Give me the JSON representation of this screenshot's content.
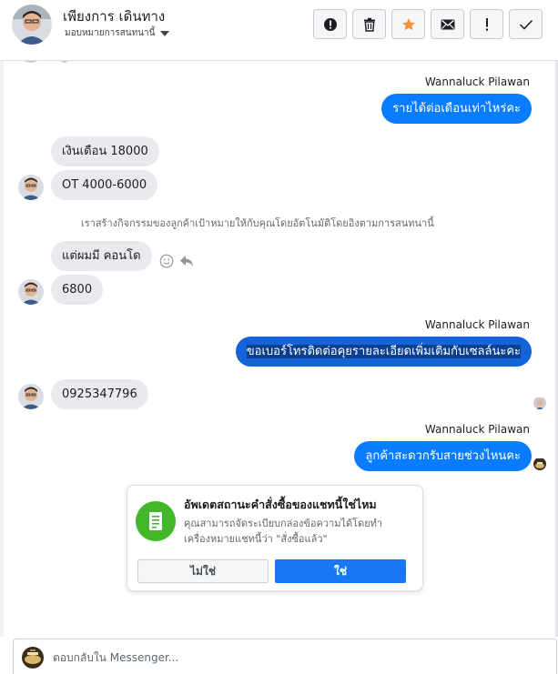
{
  "header": {
    "contact_name": "เพียงการ เดินทาง",
    "assign_label": "มอบหมายการสนทนานี้",
    "toolbar": [
      {
        "icon": "alert-circle-icon",
        "tooltip": ""
      },
      {
        "icon": "trash-icon",
        "tooltip": ""
      },
      {
        "icon": "star-icon",
        "tooltip": ""
      },
      {
        "icon": "envelope-icon",
        "tooltip": ""
      },
      {
        "icon": "exclamation-icon",
        "tooltip": ""
      },
      {
        "icon": "check-icon",
        "tooltip": ""
      }
    ]
  },
  "thread": {
    "sender_1": "Wannaluck Pilawan",
    "out_1": "รายได้ต่อเดือนเท่าไหร่คะ",
    "in_1": "เงินเดือน 18000",
    "in_2": "OT 4000-6000",
    "system_note": "เราสร้างกิจกรรมของลูกค้าเป้าหมายให้กับคุณโดยอัตโนมัติโดยอิงตามการสนทนานี้",
    "in_3": "แต่ผมมี คอนโด",
    "in_4": "6800",
    "sender_2": "Wannaluck Pilawan",
    "out_2": "ขอเบอร์โทรติดต่อคุยรายละเอียดเพิ่มเติมกับเซลล์นะคะ",
    "in_5": "0925347796",
    "sender_3": "Wannaluck Pilawan",
    "out_3": "ลูกค้าสะดวกรับสายช่วงไหนคะ"
  },
  "order_prompt": {
    "title": "อัพเดตสถานะคำสั่งซื้อของแชทนี้ใช่ไหม",
    "body": "คุณสามารถจัดระเบียบกล่องข้อความได้โดยทำเครื่องหมายแชทนี้ว่า \"สั่งซื้อแล้ว\"",
    "no_label": "ไม่ใช่",
    "yes_label": "ใช่"
  },
  "composer": {
    "placeholder": "ตอบกลับใน Messenger..."
  },
  "colors": {
    "outgoing_bubble": "#0a7cff",
    "incoming_bubble": "#e9eaee",
    "primary_button": "#1877f2",
    "order_icon_bg": "#42b72a",
    "star": "#f7923a"
  }
}
